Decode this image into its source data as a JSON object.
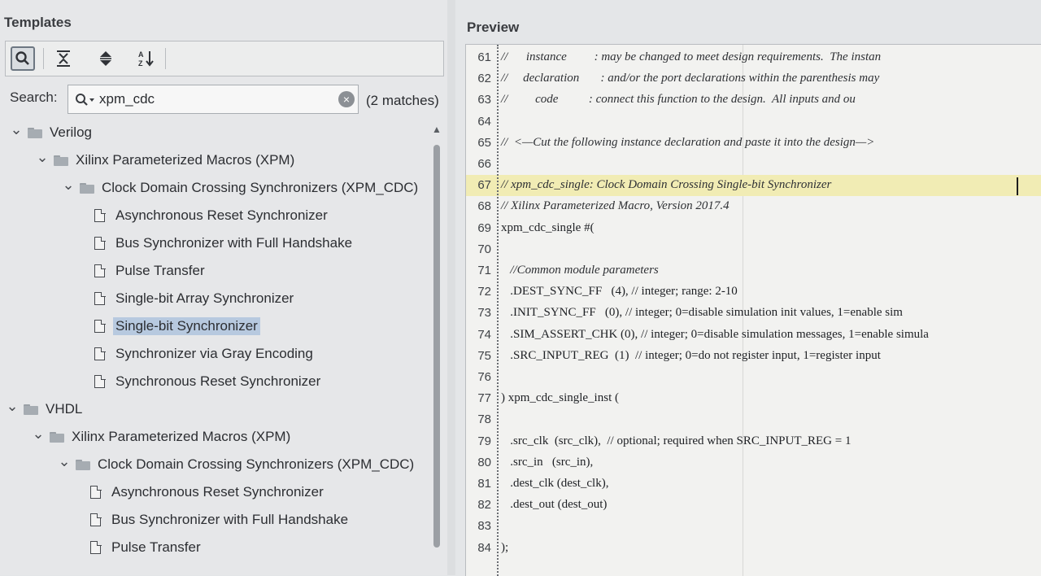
{
  "left_panel": {
    "title": "Templates",
    "toolbar": {
      "buttons": [
        {
          "icon": "search-icon"
        },
        {
          "icon": "collapse-all-icon"
        },
        {
          "icon": "expand-all-icon"
        },
        {
          "icon": "sort-az-icon"
        }
      ]
    },
    "search": {
      "label": "Search:",
      "value": "xpm_cdc",
      "match_count": "(2 matches)"
    },
    "tree": [
      {
        "label": "Verilog",
        "type": "folder",
        "level": 0,
        "expanded": true
      },
      {
        "label": "Xilinx Parameterized Macros (XPM)",
        "type": "folder",
        "level": 1,
        "expanded": true
      },
      {
        "label": "Clock Domain Crossing Synchronizers (XPM_CDC)",
        "type": "folder",
        "level": 2,
        "expanded": true
      },
      {
        "label": "Asynchronous Reset Synchronizer",
        "type": "file",
        "level": 3
      },
      {
        "label": "Bus Synchronizer with Full Handshake",
        "type": "file",
        "level": 3
      },
      {
        "label": "Pulse Transfer",
        "type": "file",
        "level": 3
      },
      {
        "label": "Single-bit Array Synchronizer",
        "type": "file",
        "level": 3
      },
      {
        "label": "Single-bit Synchronizer",
        "type": "file",
        "level": 3,
        "selected": true
      },
      {
        "label": "Synchronizer via Gray Encoding",
        "type": "file",
        "level": 3
      },
      {
        "label": "Synchronous Reset Synchronizer",
        "type": "file",
        "level": 3
      },
      {
        "label": "VHDL",
        "type": "folder",
        "level": 0,
        "expanded": true
      },
      {
        "label": "Xilinx Parameterized Macros (XPM)",
        "type": "folder",
        "level": 1,
        "expanded": true
      },
      {
        "label": "Clock Domain Crossing Synchronizers (XPM_CDC)",
        "type": "folder",
        "level": 2,
        "expanded": true
      },
      {
        "label": "Asynchronous Reset Synchronizer",
        "type": "file",
        "level": 3
      },
      {
        "label": "Bus Synchronizer with Full Handshake",
        "type": "file",
        "level": 3
      },
      {
        "label": "Pulse Transfer",
        "type": "file",
        "level": 3
      }
    ]
  },
  "preview": {
    "title": "Preview",
    "lines": [
      {
        "n": "61",
        "text": "//      instance         : may be changed to meet design requirements.  The instan",
        "comment": true
      },
      {
        "n": "62",
        "text": "//     declaration       : and/or the port declarations within the parenthesis may",
        "comment": true
      },
      {
        "n": "63",
        "text": "//         code          : connect this function to the design.  All inputs and ou",
        "comment": true
      },
      {
        "n": "64",
        "text": ""
      },
      {
        "n": "65",
        "text": "//  <—Cut the following instance declaration and paste it into the design—>",
        "comment": true
      },
      {
        "n": "66",
        "text": ""
      },
      {
        "n": "67",
        "text": "// xpm_cdc_single: Clock Domain Crossing Single-bit Synchronizer",
        "comment": true,
        "highlight": true
      },
      {
        "n": "68",
        "text": "// Xilinx Parameterized Macro, Version 2017.4",
        "comment": true
      },
      {
        "n": "69",
        "text": "xpm_cdc_single #("
      },
      {
        "n": "70",
        "text": ""
      },
      {
        "n": "71",
        "text": "   //Common module parameters",
        "comment": true
      },
      {
        "n": "72",
        "text": "   .DEST_SYNC_FF   (4), // integer; range: 2-10"
      },
      {
        "n": "73",
        "text": "   .INIT_SYNC_FF   (0), // integer; 0=disable simulation init values, 1=enable sim"
      },
      {
        "n": "74",
        "text": "   .SIM_ASSERT_CHK (0), // integer; 0=disable simulation messages, 1=enable simula"
      },
      {
        "n": "75",
        "text": "   .SRC_INPUT_REG  (1)  // integer; 0=do not register input, 1=register input"
      },
      {
        "n": "76",
        "text": ""
      },
      {
        "n": "77",
        "text": ") xpm_cdc_single_inst ("
      },
      {
        "n": "78",
        "text": ""
      },
      {
        "n": "79",
        "text": "   .src_clk  (src_clk),  // optional; required when SRC_INPUT_REG = 1"
      },
      {
        "n": "80",
        "text": "   .src_in   (src_in),"
      },
      {
        "n": "81",
        "text": "   .dest_clk (dest_clk),"
      },
      {
        "n": "82",
        "text": "   .dest_out (dest_out)"
      },
      {
        "n": "83",
        "text": ""
      },
      {
        "n": "84",
        "text": ");"
      }
    ]
  }
}
